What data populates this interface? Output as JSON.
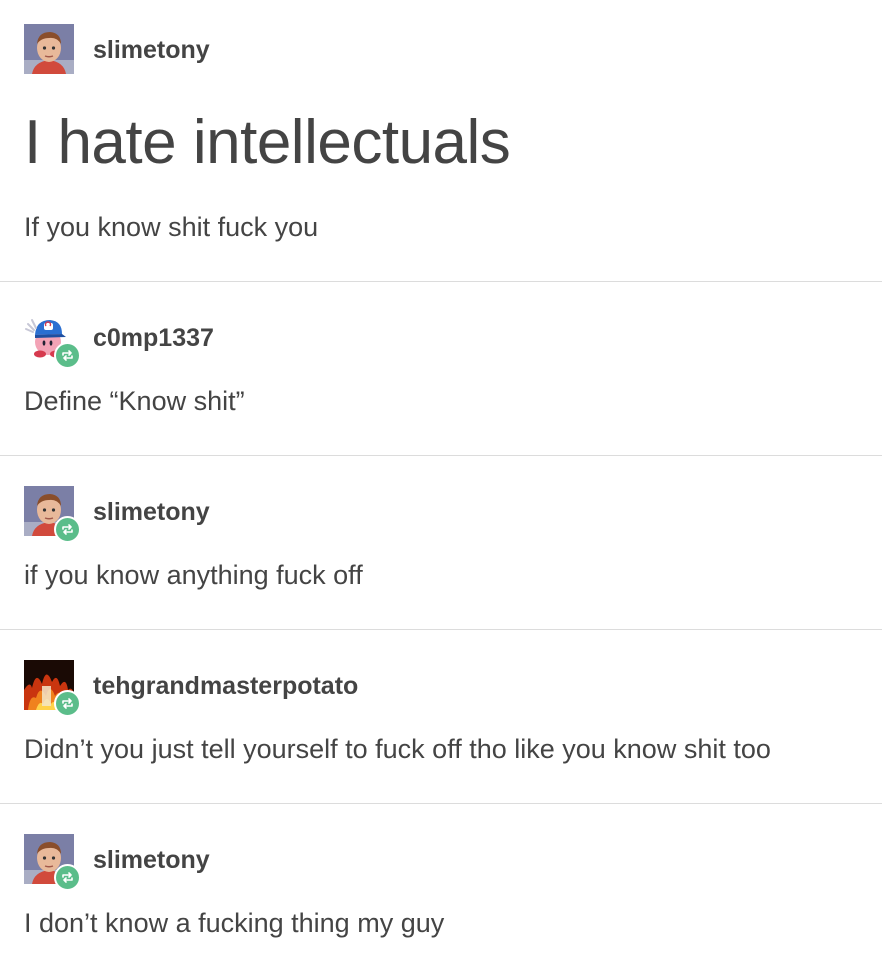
{
  "posts": [
    {
      "username": "slimetony",
      "title": "I hate intellectuals",
      "body": "If you know shit fuck you",
      "avatar_icon": "child-portrait-avatar",
      "reblog": false
    },
    {
      "username": "c0mp1337",
      "body": "Define “Know shit”",
      "avatar_icon": "kirby-with-cap-avatar",
      "reblog": true
    },
    {
      "username": "slimetony",
      "body": "if you know anything fuck off",
      "avatar_icon": "child-portrait-avatar",
      "reblog": true
    },
    {
      "username": "tehgrandmasterpotato",
      "body": "Didn’t you just tell yourself to fuck off tho like you know shit too",
      "avatar_icon": "fire-avatar",
      "reblog": true
    },
    {
      "username": "slimetony",
      "body": "I don’t know a fucking thing my guy",
      "avatar_icon": "child-portrait-avatar",
      "reblog": true
    }
  ],
  "colors": {
    "text": "#444444",
    "divider": "#dcdcdc",
    "reblog_badge": "#5bbd8a"
  }
}
